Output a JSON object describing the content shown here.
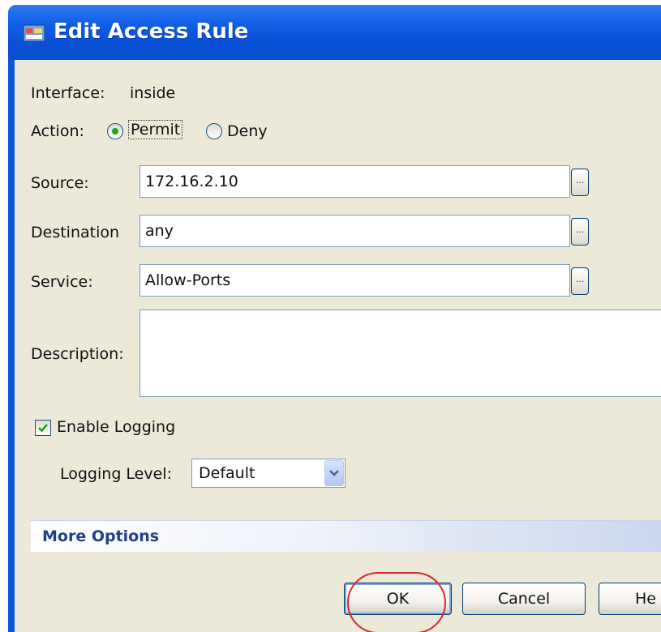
{
  "window": {
    "title": "Edit Access Rule"
  },
  "interface": {
    "label": "Interface:",
    "value": "inside"
  },
  "action": {
    "label": "Action:",
    "permit_label": "Permit",
    "deny_label": "Deny",
    "selected": "Permit"
  },
  "source": {
    "label": "Source:",
    "value": "172.16.2.10",
    "browse": "..."
  },
  "destination": {
    "label": "Destination",
    "value": "any",
    "browse": "..."
  },
  "service": {
    "label": "Service:",
    "value": "Allow-Ports",
    "browse": "..."
  },
  "description": {
    "label": "Description:",
    "value": ""
  },
  "logging": {
    "enable_label": "Enable Logging",
    "enabled": true,
    "level_label": "Logging Level:",
    "level_value": "Default"
  },
  "more_options": {
    "label": "More Options"
  },
  "buttons": {
    "ok": "OK",
    "cancel": "Cancel",
    "help_partial": "He"
  },
  "colors": {
    "titlebar": "#0c57d9",
    "dialog_bg": "#ece9d8",
    "highlight": "#d42a2a",
    "more_options_text": "#1f3f8c"
  },
  "icons": {
    "title": "app-icon",
    "dropdown": "chevron-down-icon",
    "check": "check-icon"
  }
}
